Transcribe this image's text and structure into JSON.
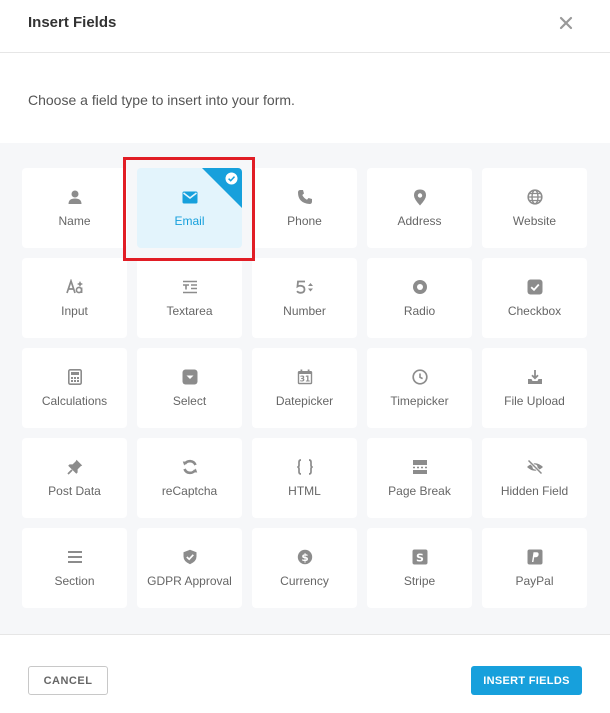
{
  "dialog": {
    "title": "Insert Fields",
    "close_icon": "close-icon",
    "intro": "Choose a field type to insert into your form."
  },
  "fields": [
    {
      "label": "Name",
      "icon": "user-icon",
      "selected": false
    },
    {
      "label": "Email",
      "icon": "envelope-icon",
      "selected": true
    },
    {
      "label": "Phone",
      "icon": "phone-icon",
      "selected": false
    },
    {
      "label": "Address",
      "icon": "map-pin-icon",
      "selected": false
    },
    {
      "label": "Website",
      "icon": "globe-icon",
      "selected": false
    },
    {
      "label": "Input",
      "icon": "text-input-icon",
      "selected": false
    },
    {
      "label": "Textarea",
      "icon": "textarea-icon",
      "selected": false
    },
    {
      "label": "Number",
      "icon": "number-icon",
      "selected": false
    },
    {
      "label": "Radio",
      "icon": "radio-icon",
      "selected": false
    },
    {
      "label": "Checkbox",
      "icon": "checkbox-icon",
      "selected": false
    },
    {
      "label": "Calculations",
      "icon": "calculator-icon",
      "selected": false
    },
    {
      "label": "Select",
      "icon": "select-icon",
      "selected": false
    },
    {
      "label": "Datepicker",
      "icon": "calendar-icon",
      "selected": false
    },
    {
      "label": "Timepicker",
      "icon": "clock-icon",
      "selected": false
    },
    {
      "label": "File Upload",
      "icon": "upload-icon",
      "selected": false
    },
    {
      "label": "Post Data",
      "icon": "pin-icon",
      "selected": false
    },
    {
      "label": "reCaptcha",
      "icon": "recaptcha-icon",
      "selected": false
    },
    {
      "label": "HTML",
      "icon": "code-icon",
      "selected": false
    },
    {
      "label": "Page Break",
      "icon": "page-break-icon",
      "selected": false
    },
    {
      "label": "Hidden Field",
      "icon": "eye-slash-icon",
      "selected": false
    },
    {
      "label": "Section",
      "icon": "section-icon",
      "selected": false
    },
    {
      "label": "GDPR Approval",
      "icon": "shield-check-icon",
      "selected": false
    },
    {
      "label": "Currency",
      "icon": "dollar-icon",
      "selected": false
    },
    {
      "label": "Stripe",
      "icon": "stripe-icon",
      "selected": false
    },
    {
      "label": "PayPal",
      "icon": "paypal-icon",
      "selected": false
    }
  ],
  "footer": {
    "cancel_label": "CANCEL",
    "insert_label": "INSERT FIELDS"
  },
  "colors": {
    "accent": "#17a0dc",
    "selected_bg": "#e3f4fc",
    "highlight": "#e11d25",
    "icon_gray": "#8c8c8c"
  }
}
